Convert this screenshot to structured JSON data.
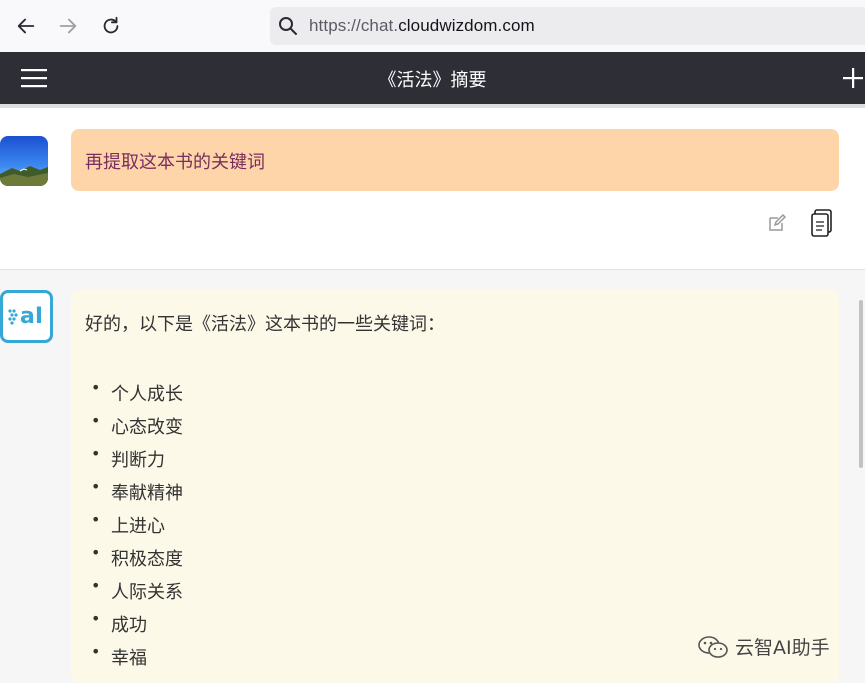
{
  "browser": {
    "url_prefix": "https://chat.",
    "url_domain": "cloudwizdom.com"
  },
  "header": {
    "title": "《活法》摘要"
  },
  "conversation": {
    "user_message": "再提取这本书的关键词",
    "ai_intro": "好的，以下是《活法》这本书的一些关键词：",
    "keywords": [
      "个人成长",
      "心态改变",
      "判断力",
      "奉献精神",
      "上进心",
      "积极态度",
      "人际关系",
      "成功",
      "幸福"
    ]
  },
  "watermark": {
    "text": "云智AI助手"
  },
  "colors": {
    "header_bg": "#2e2e36",
    "user_bubble": "#fdd5a9",
    "user_text": "#7a2d5f",
    "ai_bubble": "#fdf9e9",
    "ai_accent": "#35a8d6"
  },
  "icons": {
    "back": "back-arrow-icon",
    "forward": "forward-arrow-icon",
    "reload": "reload-icon",
    "search": "search-icon",
    "menu": "hamburger-menu-icon",
    "new_chat": "plus-icon",
    "edit": "edit-icon",
    "copy": "copy-icon",
    "ai_logo": "ai-logo-icon",
    "wechat": "wechat-icon"
  }
}
